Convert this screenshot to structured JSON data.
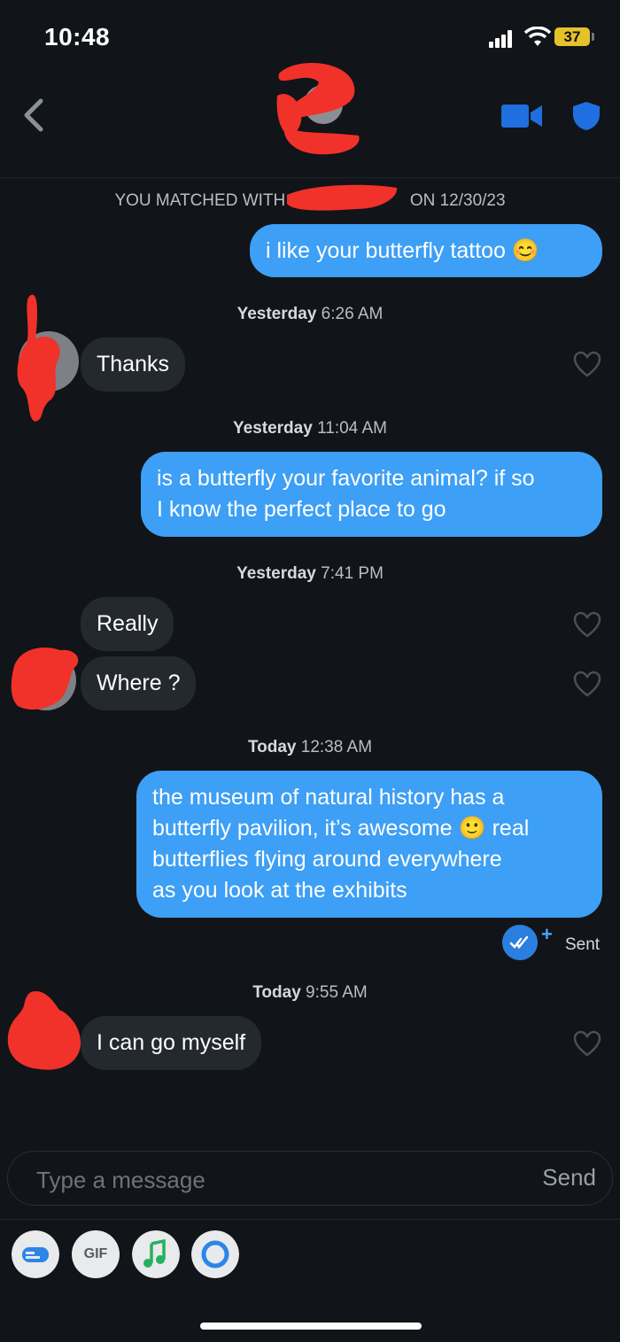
{
  "status_bar": {
    "time": "10:48",
    "battery": "37"
  },
  "match_banner": {
    "prefix": "YOU MATCHED WITH",
    "suffix": "ON 12/30/23"
  },
  "messages": [
    {
      "type": "out",
      "text": "i like your butterfly tattoo 😊"
    },
    {
      "type": "timestamp",
      "day": "Yesterday",
      "time": "6:26 AM"
    },
    {
      "type": "in",
      "text": "Thanks"
    },
    {
      "type": "timestamp",
      "day": "Yesterday",
      "time": "11:04 AM"
    },
    {
      "type": "out",
      "lines": [
        "is a butterfly your favorite animal? if so",
        "I know the perfect place to go"
      ]
    },
    {
      "type": "timestamp",
      "day": "Yesterday",
      "time": "7:41 PM"
    },
    {
      "type": "in",
      "text": "Really"
    },
    {
      "type": "in",
      "text": "Where ?"
    },
    {
      "type": "timestamp",
      "day": "Today",
      "time": "12:38 AM"
    },
    {
      "type": "out",
      "lines": [
        "the museum of natural history has a",
        "butterfly pavilion, it’s awesome 🙂 real",
        "butterflies flying around everywhere",
        "as you look at the exhibits"
      ]
    },
    {
      "type": "timestamp",
      "day": "Today",
      "time": "9:55 AM"
    },
    {
      "type": "in",
      "text": "I can go myself"
    }
  ],
  "read_receipt": {
    "label": "Sent",
    "plus": "+"
  },
  "composer": {
    "placeholder": "Type a message",
    "send_label": "Send"
  },
  "toolbar": {
    "gif_label": "GIF"
  },
  "colors": {
    "background": "#111418",
    "outgoing": "#3d9ff5",
    "incoming": "#24292f",
    "accent": "#1f6fe0",
    "redaction": "#f0322a"
  },
  "icons": [
    "back-chevron-icon",
    "video-call-icon",
    "shield-icon",
    "heart-icon",
    "read-check-icon",
    "sticker-icon",
    "gif-icon",
    "music-icon",
    "circle-icon"
  ]
}
